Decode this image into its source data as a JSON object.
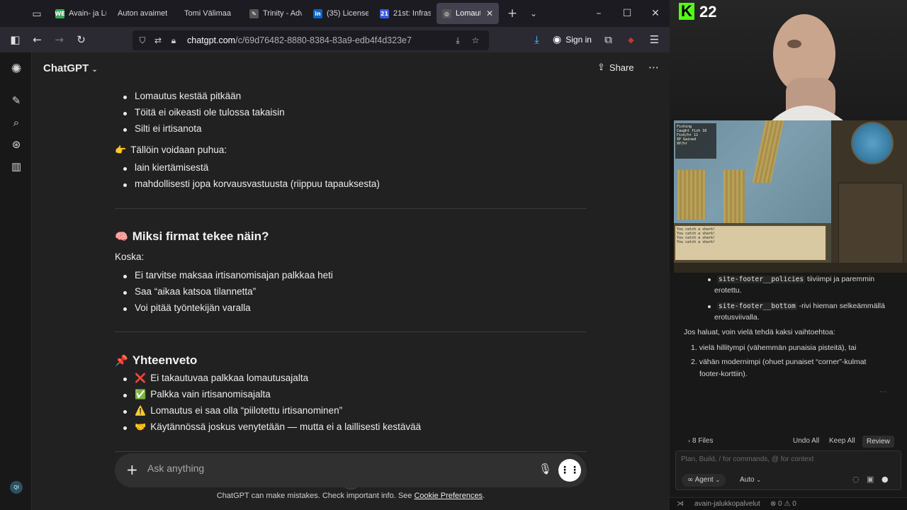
{
  "browser": {
    "tabs": [
      {
        "title": "Avain- ja Lu",
        "favicon": "WE",
        "favicon_color": "#3aa757",
        "active": false
      },
      {
        "title": "Auton avaimet",
        "favicon": "",
        "favicon_color": "",
        "active": false
      },
      {
        "title": "Tomi Välimaa",
        "favicon": "",
        "favicon_color": "",
        "active": false
      },
      {
        "title": "Trinity - Adv",
        "favicon": "✎",
        "favicon_color": "#555555",
        "active": false
      },
      {
        "title": "(35) License",
        "favicon": "in",
        "favicon_color": "#0a66c2",
        "active": false
      },
      {
        "title": "21st: Infrast",
        "favicon": "21",
        "favicon_color": "#3b5bdb",
        "active": false
      },
      {
        "title": "Lomautu",
        "favicon": "◎",
        "favicon_color": "#555555",
        "active": true
      }
    ],
    "url_domain": "chatgpt.com",
    "url_path": "/c/69d76482-8880-8384-83a9-edb4f4d323e7",
    "sign_in": "Sign in"
  },
  "app": {
    "title": "ChatGPT",
    "share": "Share"
  },
  "chat": {
    "list1": [
      "Lomautus kestää pitkään",
      "Töitä ei oikeasti ole tulossa takaisin",
      "Silti ei irtisanota"
    ],
    "pointer_line": "Tällöin voidaan puhua:",
    "list2": [
      "lain kiertämisestä",
      "mahdollisesti jopa korvausvastuusta (riippuu tapauksesta)"
    ],
    "heading1": "Miksi firmat tekee näin?",
    "koska": "Koska:",
    "list3": [
      "Ei tarvitse maksaa irtisanomisajan palkkaa heti",
      "Saa “aikaa katsoa tilannetta”",
      "Voi pitää työntekijän varalla"
    ],
    "heading2": "Yhteenveto",
    "summary": [
      {
        "emoji": "❌",
        "text": "Ei takautuvaa palkkaa lomautusajalta"
      },
      {
        "emoji": "✅",
        "text": "Palkka vain irtisanomisajalta"
      },
      {
        "emoji": "⚠️",
        "text": "Lomautus ei saa olla “piilotettu irtisanominen”"
      },
      {
        "emoji": "🤝",
        "text": "Käytännössä joskus venytetään — mutta ei a  laillisesti kestävää"
      }
    ]
  },
  "composer": {
    "placeholder": "Ask anything"
  },
  "disclaimer": {
    "text": "ChatGPT can make mistakes. Check important info. See ",
    "link": "Cookie Preferences",
    "end": "."
  },
  "stream": {
    "channel_number": "22",
    "brand_color": "#53fc18"
  },
  "ai_panel": {
    "item1_code": "site-footer__policies",
    "item1_text": " tiiviimpi ja paremmin",
    "item1_text2": "erotettu.",
    "item2_code": "site-footer__bottom",
    "item2_text": " -rivi hieman selkeämmällä",
    "item2_text2": "erotusviivalla.",
    "intro": "Jos haluat, voin vielä tehdä kaksi vaihtoehtoa:",
    "opt1": "vielä hillitympi (vähemmän punaisia pisteitä), tai",
    "opt2a": "vähän modernimpi (ohuet punaiset “corner”-kulmat",
    "opt2b": "footer-korttiin).",
    "files": "8 Files",
    "undo_all": "Undo All",
    "keep_all": "Keep All",
    "review": "Review",
    "input_placeholder": "Plan, Build, / for commands, @ for context",
    "agent": "Agent",
    "auto": "Auto",
    "status_project": "avain-jalukkopalvelut",
    "status_counts": "⊗ 0 ⚠ 0"
  }
}
